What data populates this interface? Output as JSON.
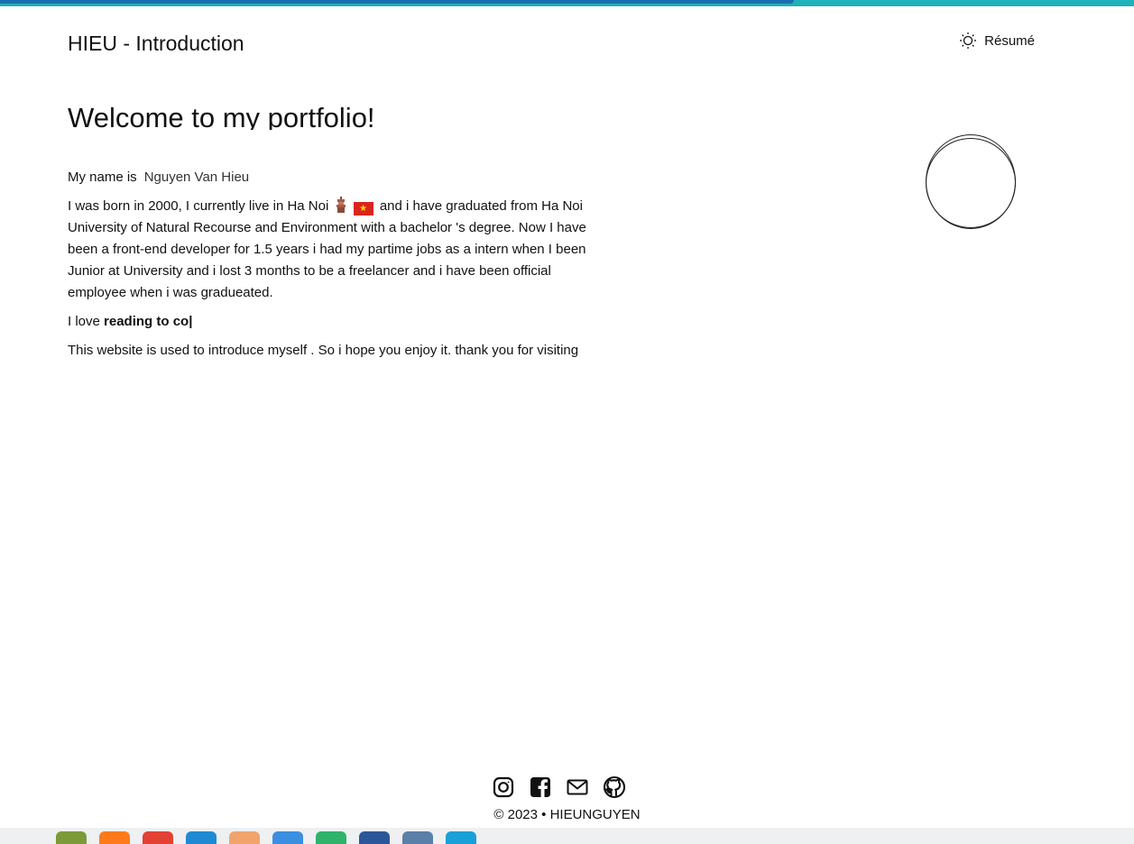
{
  "progress": {
    "fraction": 0.7
  },
  "header": {
    "title": "HIEU - Introduction",
    "resume_label": "Résumé"
  },
  "main": {
    "heading": "Welcome to my portfolio!",
    "name_label": "My name is",
    "name_value": "Nguyen Van Hieu",
    "bio_part1": "I was born in 2000, I currently live in Ha Noi",
    "bio_part2": "and i have graduated from Ha Noi University of Natural Recourse and Environment with a bachelor 's degree. Now I have been a front-end developer for 1.5 years i had my partime jobs as a intern when I been Junior at University and i lost 3 months to be a freelancer and i have been official employee when i was gradueated.",
    "love_prefix": "I love",
    "love_typed": "reading to co|",
    "closing": "This website is used to introduce myself . So i hope you enjoy it. thank you for visiting"
  },
  "footer": {
    "social_icons": [
      "instagram-icon",
      "facebook-icon",
      "mail-icon",
      "github-icon"
    ],
    "copyright": "© 2023 • HIEUNGUYEN"
  },
  "taskbar": {
    "icons": [
      "plant-icon",
      "firefox-icon",
      "chrome-icon",
      "vscode-icon",
      "teams-icon",
      "zalo-icon",
      "app-icon",
      "word-icon",
      "calculator-icon",
      "edge-icon"
    ],
    "colors": [
      "#7d9a3a",
      "#ff7a1a",
      "#e34133",
      "#1f8ad2",
      "#f2a36b",
      "#3b8fe0",
      "#2fb36b",
      "#2b579a",
      "#5a7fa8",
      "#1aa0d8"
    ]
  }
}
